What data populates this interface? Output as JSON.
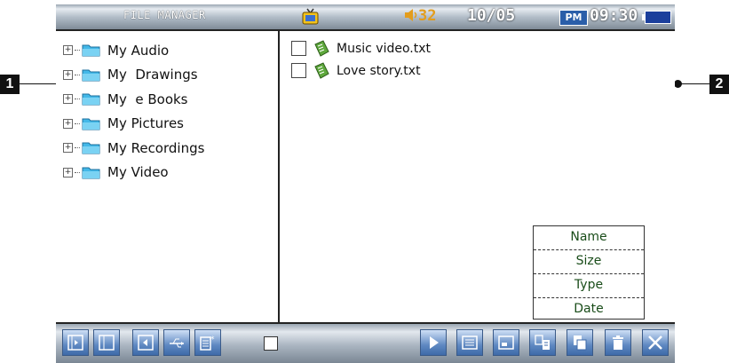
{
  "statusbar": {
    "title": "FILE MANAGER",
    "volume": "32",
    "date": "10/05",
    "ampm": "PM",
    "time": "09:30"
  },
  "folders": [
    {
      "label": "My Audio"
    },
    {
      "label": "My  Drawings"
    },
    {
      "label": "My  e Books"
    },
    {
      "label": "My Pictures"
    },
    {
      "label": "My Recordings"
    },
    {
      "label": "My Video"
    }
  ],
  "files": [
    {
      "name": "Music video.txt"
    },
    {
      "name": "Love story.txt"
    }
  ],
  "sort_menu": [
    "Name",
    "Size",
    "Type",
    "Date"
  ],
  "callouts": {
    "left": "1",
    "right": "2"
  },
  "colors": {
    "volume": "#e39d1d",
    "sort_text": "#1a4d1a",
    "pm_badge": "#2a5ea9"
  }
}
